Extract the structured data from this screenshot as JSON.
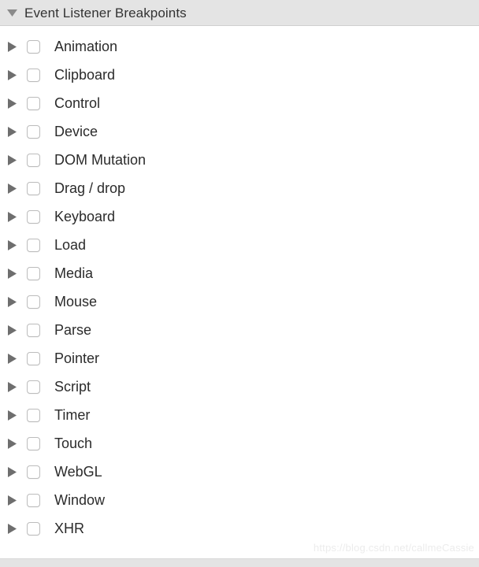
{
  "panel": {
    "header": {
      "title": "Event Listener Breakpoints",
      "twisty_icon": "triangle-down-icon",
      "expanded": true,
      "background_color": "#e4e4e4",
      "text_color": "#333333"
    },
    "row_icons": {
      "twisty_icon": "triangle-right-icon",
      "checkbox_icon": "checkbox-unchecked-icon"
    },
    "items": [
      {
        "label": "Animation",
        "checked": false,
        "expanded": false
      },
      {
        "label": "Clipboard",
        "checked": false,
        "expanded": false
      },
      {
        "label": "Control",
        "checked": false,
        "expanded": false
      },
      {
        "label": "Device",
        "checked": false,
        "expanded": false
      },
      {
        "label": "DOM Mutation",
        "checked": false,
        "expanded": false
      },
      {
        "label": "Drag / drop",
        "checked": false,
        "expanded": false
      },
      {
        "label": "Keyboard",
        "checked": false,
        "expanded": false
      },
      {
        "label": "Load",
        "checked": false,
        "expanded": false
      },
      {
        "label": "Media",
        "checked": false,
        "expanded": false
      },
      {
        "label": "Mouse",
        "checked": false,
        "expanded": false
      },
      {
        "label": "Parse",
        "checked": false,
        "expanded": false
      },
      {
        "label": "Pointer",
        "checked": false,
        "expanded": false
      },
      {
        "label": "Script",
        "checked": false,
        "expanded": false
      },
      {
        "label": "Timer",
        "checked": false,
        "expanded": false
      },
      {
        "label": "Touch",
        "checked": false,
        "expanded": false
      },
      {
        "label": "WebGL",
        "checked": false,
        "expanded": false
      },
      {
        "label": "Window",
        "checked": false,
        "expanded": false
      },
      {
        "label": "XHR",
        "checked": false,
        "expanded": false
      }
    ]
  },
  "watermark": {
    "text": "https://blog.csdn.net/callmeCassie",
    "color": "#ececec"
  }
}
